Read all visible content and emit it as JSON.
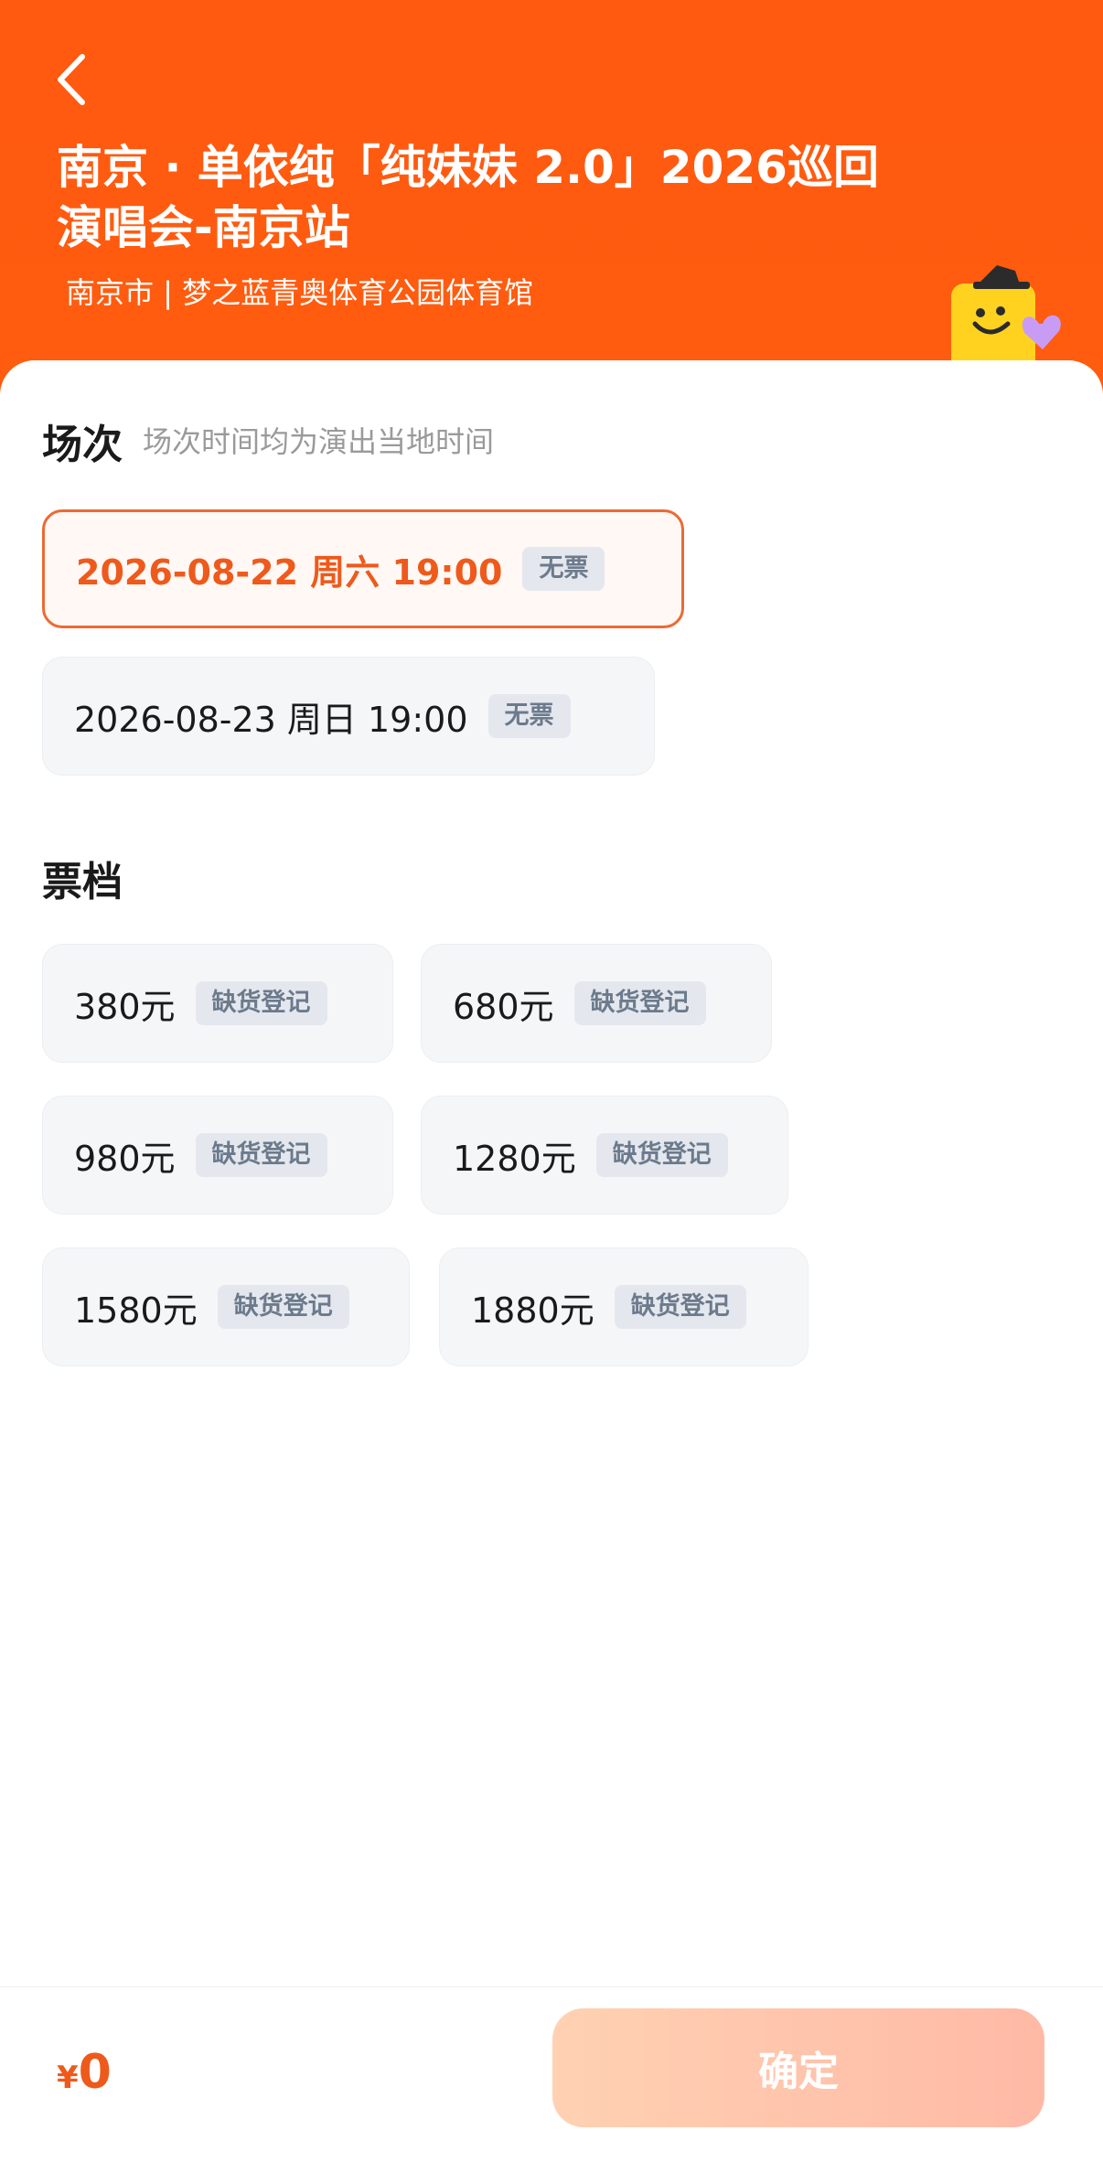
{
  "header": {
    "title_line1": "南京 · 单依纯「纯妹妹 2.0」2026巡回",
    "title_line2": "演唱会-南京站",
    "venue": "南京市 | 梦之蓝青奥体育公园体育馆",
    "background_color": "#ff5a10"
  },
  "sessions": {
    "title": "场次",
    "hint": "场次时间均为演出当地时间",
    "items": [
      {
        "label": "2026-08-22  周六 19:00",
        "tag": "无票",
        "selected": true
      },
      {
        "label": "2026-08-23 周日 19:00",
        "tag": "无票",
        "selected": false
      }
    ]
  },
  "tickets": {
    "title": "票档",
    "items": [
      {
        "label": "380元",
        "tag": "缺货登记"
      },
      {
        "label": "680元",
        "tag": "缺货登记"
      },
      {
        "label": "980元",
        "tag": "缺货登记"
      },
      {
        "label": "1280元",
        "tag": "缺货登记"
      },
      {
        "label": "1580元",
        "tag": "缺货登记"
      },
      {
        "label": "1880元",
        "tag": "缺货登记"
      }
    ]
  },
  "footer": {
    "currency": "¥",
    "amount": "0",
    "confirm_label": "确定"
  },
  "colors": {
    "accent": "#ee5a1c",
    "selected_border": "#ec6a33",
    "tag_bg": "#e4e8ee",
    "tag_text": "#6c7a8c"
  },
  "icons": [
    "back-chevron-icon",
    "mascot-icon"
  ]
}
